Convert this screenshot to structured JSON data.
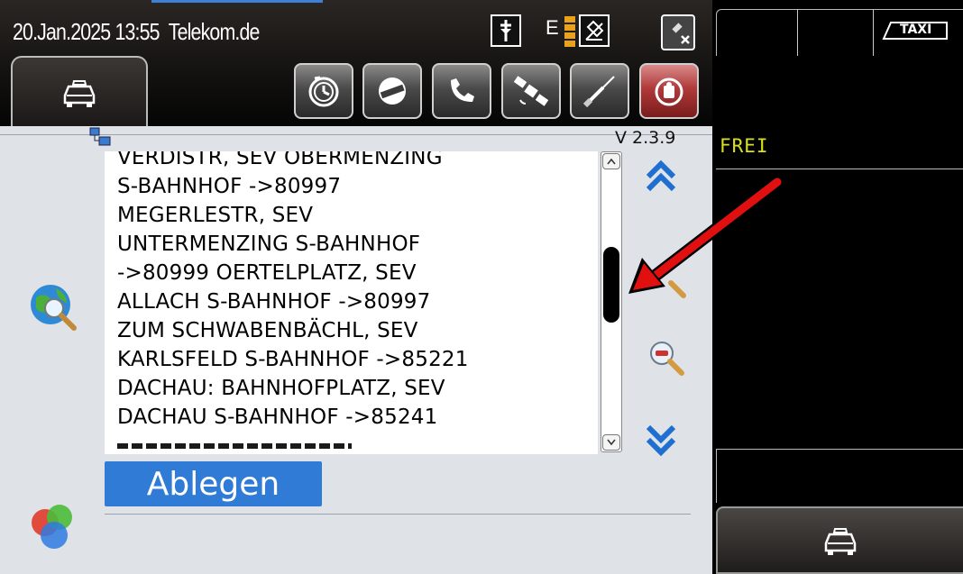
{
  "header": {
    "datetime": "20.Jan.2025 13:55",
    "network": "Telekom.de",
    "status_e": "E",
    "toolbar_icons": [
      "clock-icon",
      "no-entry-icon",
      "phone-icon",
      "satellite-icon",
      "wrench-icon",
      "power-icon"
    ]
  },
  "version": "V 2.3.9",
  "message": {
    "lines": [
      "VERDISTR, SEV OBERMENZING",
      "S-BAHNHOF ->80997",
      "MEGERLESTR, SEV",
      "UNTERMENZING S-BAHNHOF",
      "->80999 OERTELPLATZ, SEV",
      "ALLACH S-BAHNHOF ->80997",
      "ZUM SCHWABENBÄCHL, SEV",
      "KARLSFELD S-BAHNHOF ->85221",
      "DACHAU: BAHNHOFPLATZ, SEV",
      "DACHAU S-BAHNHOF ->85241"
    ]
  },
  "actions": {
    "ablegen": "Ablegen"
  },
  "right_panel": {
    "taxi_badge": "TAXI",
    "status": "FREI"
  },
  "colors": {
    "accent_blue": "#2f7bd6",
    "status_yellow": "#d8e020",
    "arrow_red": "#e01010"
  }
}
